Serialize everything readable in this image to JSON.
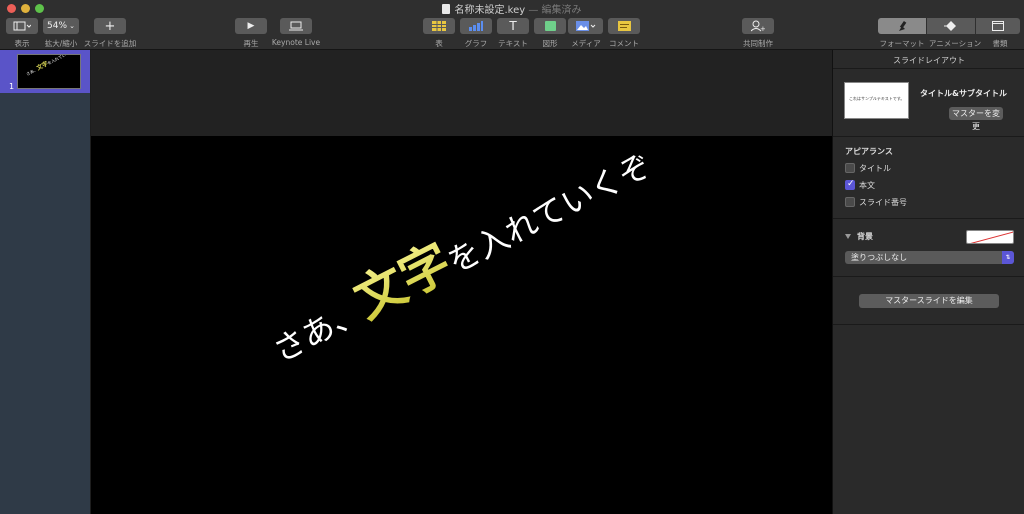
{
  "window": {
    "title": "名称未設定.key",
    "separator": "—",
    "status": "編集済み"
  },
  "toolbar": {
    "view_label": "表示",
    "zoom_value": "54%",
    "zoom_label": "拡大/縮小",
    "add_slide_label": "スライドを追加",
    "play_label": "再生",
    "keynote_live_label": "Keynote Live",
    "table_label": "表",
    "chart_label": "グラフ",
    "text_label": "テキスト",
    "shape_label": "図形",
    "media_label": "メディア",
    "comment_label": "コメント",
    "collaborate_label": "共同制作",
    "format_label": "フォーマット",
    "animate_label": "アニメーション",
    "document_label": "書類"
  },
  "navigator": {
    "slides": [
      {
        "number": "1",
        "selected": true
      }
    ]
  },
  "slide": {
    "text_before": "さあ、",
    "text_highlight": "文字",
    "text_after": "を入れていくぞ",
    "background": "#000000",
    "highlight_color": "#e2de58"
  },
  "inspector": {
    "title": "スライドレイアウト",
    "master_preview_text": "これはサンプルテキストです。",
    "master_name": "タイトル&サブタイトル",
    "change_master_button": "マスターを変更",
    "appearance_title": "アピアランス",
    "appearance_items": [
      {
        "label": "タイトル",
        "checked": false
      },
      {
        "label": "本文",
        "checked": true
      },
      {
        "label": "スライド番号",
        "checked": false
      }
    ],
    "background_title": "背景",
    "fill_select_value": "塗りつぶしなし",
    "edit_master_button": "マスタースライドを編集"
  },
  "colors": {
    "accent": "#5b56d6",
    "navigator_bg": "#2f3a47",
    "selection": "#5a54c8"
  }
}
